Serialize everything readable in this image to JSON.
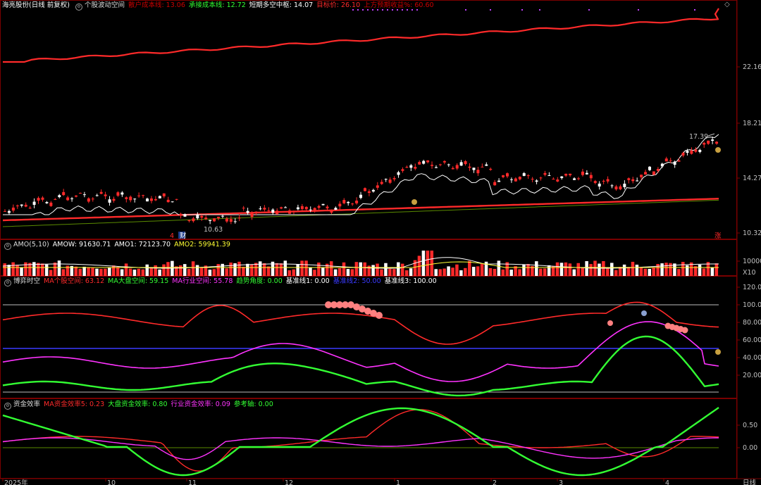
{
  "colors": {
    "bg": "#000000",
    "panel_border": "#7a0000",
    "red": "#ff2a2a",
    "white": "#ffffff",
    "green": "#33ff33",
    "magenta": "#ff33ff",
    "yellow": "#ffff33",
    "blue": "#3a3aff",
    "olive": "#5a8a00",
    "gray_line": "#bdbdbd",
    "axis_text": "#c0c0c0",
    "header_title": "#ffffff",
    "dark_red_text": "#cc0000",
    "purple_dots": "#c040ff"
  },
  "top_panel": {
    "title": "海亮股份(日线 前复权)",
    "indicator_name": "个股波动空间",
    "items": [
      {
        "label": "散户成本线",
        "value": "13.06",
        "color": "#cc0000"
      },
      {
        "label": "承接成本线",
        "value": "12.72",
        "color": "#33ff33"
      },
      {
        "label": "短期多空中枢",
        "value": "14.07",
        "color": "#ffffff"
      },
      {
        "label": "目标价",
        "value": "26.10",
        "color": "#ff2a2a"
      },
      {
        "label": "上方预期收益%",
        "value": "60.60",
        "color": "#cc0000"
      }
    ],
    "y_ticks": [
      "22.16",
      "18.21",
      "14.27",
      "10.32"
    ],
    "annotations": {
      "high_label": "17.39",
      "low_label": "10.63",
      "cai_label": "财",
      "zhang_label": "涨"
    }
  },
  "amo_panel": {
    "title": "AMO(5,10)",
    "items": [
      {
        "label": "AMOW",
        "value": "91630.71",
        "color": "#ffffff"
      },
      {
        "label": "AMO1",
        "value": "72123.70",
        "color": "#ffffff"
      },
      {
        "label": "AMO2",
        "value": "59941.39",
        "color": "#ffff33"
      }
    ],
    "y_ticks": [
      "10000"
    ],
    "unit": "X10"
  },
  "bokai_panel": {
    "title": "博弈时空",
    "items": [
      {
        "label": "MA个股空间",
        "value": "63.12",
        "color": "#ff2a2a"
      },
      {
        "label": "MA大盘空间",
        "value": "59.15",
        "color": "#33ff33"
      },
      {
        "label": "MA行业空间",
        "value": "55.78",
        "color": "#ff33ff"
      },
      {
        "label": "趋势角度",
        "value": "0.00",
        "color": "#33ff33"
      },
      {
        "label": "基准线1",
        "value": "0.00",
        "color": "#ffffff"
      },
      {
        "label": "基准线2",
        "value": "50.00",
        "color": "#3a3aff"
      },
      {
        "label": "基准线3",
        "value": "100.00",
        "color": "#ffffff"
      }
    ],
    "y_ticks": [
      "120.00",
      "100.00",
      "80.00",
      "60.00",
      "40.00",
      "20.00"
    ]
  },
  "fund_panel": {
    "title": "资金效率",
    "items": [
      {
        "label": "MA资金效率5",
        "value": "0.23",
        "color": "#ff2a2a"
      },
      {
        "label": "大盘资金效率",
        "value": "0.80",
        "color": "#33ff33"
      },
      {
        "label": "行业资金效率",
        "value": "0.09",
        "color": "#ff33ff"
      },
      {
        "label": "参考轴",
        "value": "0.00",
        "color": "#33ff33"
      }
    ],
    "y_ticks": [
      "0.50",
      "0.00"
    ]
  },
  "x_axis": {
    "labels": [
      "2025年",
      "10",
      "11",
      "12",
      "1",
      "2",
      "3",
      "4"
    ],
    "period": "日线"
  }
}
